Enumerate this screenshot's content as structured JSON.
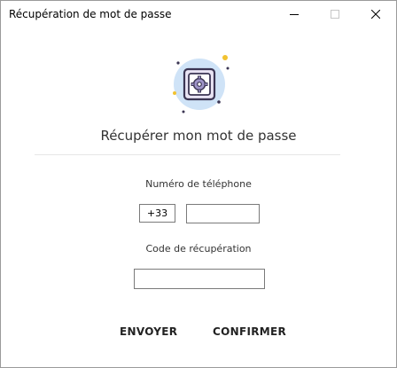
{
  "window": {
    "title": "Récupération de mot de passe"
  },
  "main": {
    "heading": "Récupérer mon mot de passe",
    "phone": {
      "label": "Numéro de téléphone",
      "country_code": "+33",
      "value": ""
    },
    "code": {
      "label": "Code de récupération",
      "value": ""
    }
  },
  "actions": {
    "send_label": "ENVOYER",
    "confirm_label": "CONFIRMER"
  },
  "icons": {
    "illustration": "gear-box-icon",
    "close": "close-icon",
    "minimize": "minimize-icon",
    "maximize": "maximize-icon"
  },
  "colors": {
    "illustration_circle": "#cfe3f7",
    "illustration_box": "#e9e4f4",
    "accent_dot": "#f2c230",
    "dark_outline": "#3b3553"
  }
}
